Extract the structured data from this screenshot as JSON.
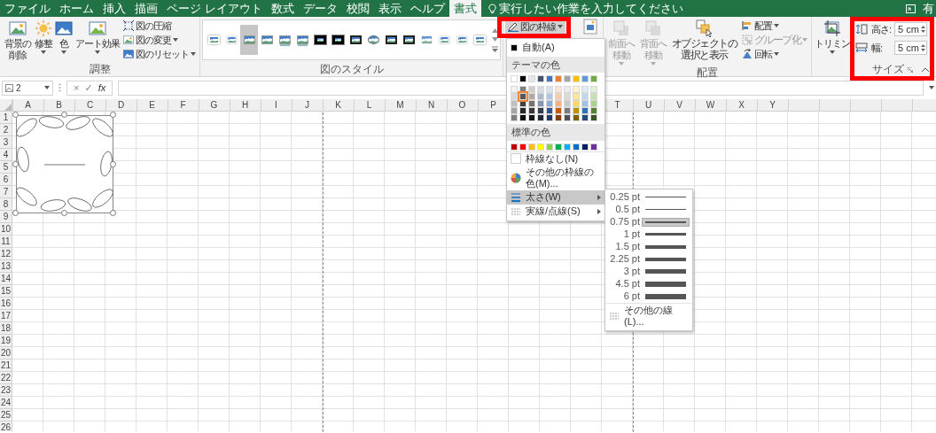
{
  "tabs": [
    {
      "label": "ファイル",
      "selected": false
    },
    {
      "label": "ホーム",
      "selected": false
    },
    {
      "label": "挿入",
      "selected": false
    },
    {
      "label": "描画",
      "selected": false
    },
    {
      "label": "ページ レイアウト",
      "selected": false
    },
    {
      "label": "数式",
      "selected": false
    },
    {
      "label": "データ",
      "selected": false
    },
    {
      "label": "校閲",
      "selected": false
    },
    {
      "label": "表示",
      "selected": false
    },
    {
      "label": "ヘルプ",
      "selected": false
    },
    {
      "label": "書式",
      "selected": true
    }
  ],
  "tell_me": {
    "placeholder": "実行したい作業を入力してください"
  },
  "share": {
    "label": "有"
  },
  "adjust_group": {
    "label": "調整",
    "large_buttons": [
      {
        "kind": "remove-background",
        "label": "背景の削除",
        "dropdown": false
      },
      {
        "kind": "corrections",
        "label": "修整",
        "dropdown": true
      },
      {
        "kind": "color",
        "label": "色",
        "dropdown": true
      },
      {
        "kind": "artistic",
        "label": "アート効果",
        "dropdown": true
      }
    ],
    "small_buttons": [
      {
        "kind": "compress",
        "label": "図の圧縮",
        "dropdown": false
      },
      {
        "kind": "change",
        "label": "図の変更",
        "dropdown": true
      },
      {
        "kind": "reset",
        "label": "図のリセット",
        "dropdown": true
      }
    ]
  },
  "styles_group": {
    "label": "図のスタイル",
    "styles": [
      {
        "kind": "white-frame",
        "selected": false
      },
      {
        "kind": "rounded",
        "selected": false
      },
      {
        "kind": "plain",
        "selected": true
      },
      {
        "kind": "plain",
        "selected": false
      },
      {
        "kind": "reflected",
        "selected": false
      },
      {
        "kind": "reflected",
        "selected": false
      },
      {
        "kind": "thick-black",
        "selected": false
      },
      {
        "kind": "thick-black",
        "selected": false
      },
      {
        "kind": "black-frame",
        "selected": false
      },
      {
        "kind": "oval",
        "selected": false
      },
      {
        "kind": "black-frame",
        "selected": false
      },
      {
        "kind": "black-frame",
        "selected": false
      },
      {
        "kind": "soft-edge",
        "selected": false
      },
      {
        "kind": "rounded",
        "selected": false
      },
      {
        "kind": "rounded",
        "selected": false
      },
      {
        "kind": "white-frame",
        "selected": false
      }
    ]
  },
  "border_button": {
    "label": "図の枠線",
    "dropdown": true,
    "expanded": true,
    "highlight": true
  },
  "border_menu": {
    "auto": {
      "label": "自動(A)",
      "color": "#000000"
    },
    "theme_heading": "テーマの色",
    "theme_base": [
      {
        "color": "#ffffff",
        "selected": false
      },
      {
        "color": "#000000",
        "selected": false
      },
      {
        "color": "#e7e6e6",
        "selected": false
      },
      {
        "color": "#44546a",
        "selected": false
      },
      {
        "color": "#4472c4",
        "selected": false
      },
      {
        "color": "#ed7d31",
        "selected": false
      },
      {
        "color": "#a5a5a5",
        "selected": false
      },
      {
        "color": "#ffc000",
        "selected": false
      },
      {
        "color": "#5b9bd5",
        "selected": false
      },
      {
        "color": "#70ad47",
        "selected": false
      }
    ],
    "theme_shades": [
      {
        "swatches": [
          {
            "color": "#f2f2f2",
            "selected": false
          },
          {
            "color": "#7f7f7f",
            "selected": false
          },
          {
            "color": "#d0cece",
            "selected": false
          },
          {
            "color": "#d6dce4",
            "selected": false
          },
          {
            "color": "#d9e2f3",
            "selected": false
          },
          {
            "color": "#fbe5d5",
            "selected": false
          },
          {
            "color": "#ededed",
            "selected": false
          },
          {
            "color": "#fff2cc",
            "selected": false
          },
          {
            "color": "#deebf6",
            "selected": false
          },
          {
            "color": "#e2efd9",
            "selected": false
          }
        ]
      },
      {
        "swatches": [
          {
            "color": "#d9d9d9",
            "selected": false
          },
          {
            "color": "#595959",
            "selected": true
          },
          {
            "color": "#aeaaaa",
            "selected": false
          },
          {
            "color": "#adb9ca",
            "selected": false
          },
          {
            "color": "#b4c6e7",
            "selected": false
          },
          {
            "color": "#f7cbac",
            "selected": false
          },
          {
            "color": "#dbdbdb",
            "selected": false
          },
          {
            "color": "#fee599",
            "selected": false
          },
          {
            "color": "#bdd7ee",
            "selected": false
          },
          {
            "color": "#c5e0b3",
            "selected": false
          }
        ]
      },
      {
        "swatches": [
          {
            "color": "#bfbfbf",
            "selected": false
          },
          {
            "color": "#404040",
            "selected": false
          },
          {
            "color": "#757171",
            "selected": false
          },
          {
            "color": "#8496b0",
            "selected": false
          },
          {
            "color": "#8eaadb",
            "selected": false
          },
          {
            "color": "#f4b183",
            "selected": false
          },
          {
            "color": "#c9c9c9",
            "selected": false
          },
          {
            "color": "#ffd965",
            "selected": false
          },
          {
            "color": "#9dc3e6",
            "selected": false
          },
          {
            "color": "#a8d08d",
            "selected": false
          }
        ]
      },
      {
        "swatches": [
          {
            "color": "#a6a6a6",
            "selected": false
          },
          {
            "color": "#262626",
            "selected": false
          },
          {
            "color": "#3a3838",
            "selected": false
          },
          {
            "color": "#333f4f",
            "selected": false
          },
          {
            "color": "#2f5496",
            "selected": false
          },
          {
            "color": "#c55a11",
            "selected": false
          },
          {
            "color": "#7b7b7b",
            "selected": false
          },
          {
            "color": "#bf9000",
            "selected": false
          },
          {
            "color": "#2e75b5",
            "selected": false
          },
          {
            "color": "#538135",
            "selected": false
          }
        ]
      },
      {
        "swatches": [
          {
            "color": "#808080",
            "selected": false
          },
          {
            "color": "#0d0d0d",
            "selected": false
          },
          {
            "color": "#161616",
            "selected": false
          },
          {
            "color": "#222a35",
            "selected": false
          },
          {
            "color": "#1f3864",
            "selected": false
          },
          {
            "color": "#833c0b",
            "selected": false
          },
          {
            "color": "#525252",
            "selected": false
          },
          {
            "color": "#7f6000",
            "selected": false
          },
          {
            "color": "#1e4e79",
            "selected": false
          },
          {
            "color": "#375623",
            "selected": false
          }
        ]
      }
    ],
    "standard_heading": "標準の色",
    "standard_colors": [
      {
        "color": "#c00000",
        "selected": false
      },
      {
        "color": "#ff0000",
        "selected": false
      },
      {
        "color": "#ffc000",
        "selected": false
      },
      {
        "color": "#ffff00",
        "selected": false
      },
      {
        "color": "#92d050",
        "selected": false
      },
      {
        "color": "#00b050",
        "selected": false
      },
      {
        "color": "#00b0f0",
        "selected": false
      },
      {
        "color": "#0070c0",
        "selected": false
      },
      {
        "color": "#002060",
        "selected": false
      },
      {
        "color": "#7030a0",
        "selected": false
      }
    ],
    "items": [
      {
        "kind": "no-outline",
        "label": "枠線なし(N)",
        "highlighted": false,
        "submenu": false
      },
      {
        "kind": "more-colors",
        "label": "その他の枠線の色(M)...",
        "highlighted": false,
        "submenu": false
      },
      {
        "kind": "weight",
        "label": "太さ(W)",
        "highlighted": true,
        "submenu": true
      },
      {
        "kind": "dashes",
        "label": "実線/点線(S)",
        "highlighted": false,
        "submenu": true
      }
    ]
  },
  "weight_menu": {
    "options": [
      {
        "label": "0.25 pt",
        "selected": false
      },
      {
        "label": "0.5 pt",
        "selected": false
      },
      {
        "label": "0.75 pt",
        "selected": true
      },
      {
        "label": "1 pt",
        "selected": false
      },
      {
        "label": "1.5 pt",
        "selected": false
      },
      {
        "label": "2.25 pt",
        "selected": false
      },
      {
        "label": "3 pt",
        "selected": false
      },
      {
        "label": "4.5 pt",
        "selected": false
      },
      {
        "label": "6 pt",
        "selected": false
      }
    ],
    "more": {
      "label": "その他の線(L)..."
    }
  },
  "arrange_group": {
    "label": "配置",
    "large_buttons": [
      {
        "kind": "bring-forward",
        "label": "前面へ移動",
        "dropdown": true,
        "disabled": true
      },
      {
        "kind": "send-backward",
        "label": "背面へ移動",
        "dropdown": true,
        "disabled": true
      },
      {
        "kind": "selection-pane",
        "label": "オブジェクトの選択と表示",
        "dropdown": false,
        "disabled": false
      }
    ],
    "small_buttons": [
      {
        "kind": "align",
        "label": "配置",
        "dropdown": true,
        "disabled": false
      },
      {
        "kind": "group",
        "label": "グループ化",
        "dropdown": true,
        "disabled": true
      },
      {
        "kind": "rotate",
        "label": "回転",
        "dropdown": true,
        "disabled": false
      }
    ]
  },
  "size_group": {
    "label": "サイズ",
    "highlight": true,
    "crop": {
      "kind": "crop",
      "label": "トリミン",
      "dropdown": true
    },
    "fields": [
      {
        "kind": "height",
        "label": "高さ:",
        "value": "5 cm"
      },
      {
        "kind": "width",
        "label": "幅:",
        "value": "5 cm"
      }
    ]
  },
  "formula_bar": {
    "name_box": "2",
    "cancel": "×",
    "enter": "✓",
    "function": "fx"
  },
  "sheet": {
    "columns": [
      {
        "label": "A",
        "page_break": false
      },
      {
        "label": "B",
        "page_break": false
      },
      {
        "label": "C",
        "page_break": false
      },
      {
        "label": "D",
        "page_break": false
      },
      {
        "label": "E",
        "page_break": false
      },
      {
        "label": "F",
        "page_break": false
      },
      {
        "label": "G",
        "page_break": false
      },
      {
        "label": "H",
        "page_break": false
      },
      {
        "label": "I",
        "page_break": false
      },
      {
        "label": "J",
        "page_break": true
      },
      {
        "label": "K",
        "page_break": false
      },
      {
        "label": "L",
        "page_break": false
      },
      {
        "label": "M",
        "page_break": false
      },
      {
        "label": "N",
        "page_break": false
      },
      {
        "label": "O",
        "page_break": false
      },
      {
        "label": "P",
        "page_break": false
      },
      {
        "page_break": false
      },
      {
        "page_break": false
      },
      {
        "page_break": false
      },
      {
        "label": "T",
        "page_break": true
      },
      {
        "label": "U",
        "page_break": false
      },
      {
        "label": "V",
        "page_break": false
      },
      {
        "label": "W",
        "page_break": false
      },
      {
        "label": "X",
        "page_break": false
      },
      {
        "label": "Y",
        "page_break": false
      }
    ],
    "rows": [
      "1",
      "2",
      "3",
      "4",
      "5",
      "6",
      "7",
      "8",
      "9",
      "10",
      "11",
      "12",
      "13",
      "14",
      "15",
      "16",
      "17",
      "18",
      "19",
      "20",
      "21",
      "22",
      "23",
      "24",
      "25",
      "26"
    ],
    "picture": {
      "kind": "picture",
      "selected": true
    }
  }
}
